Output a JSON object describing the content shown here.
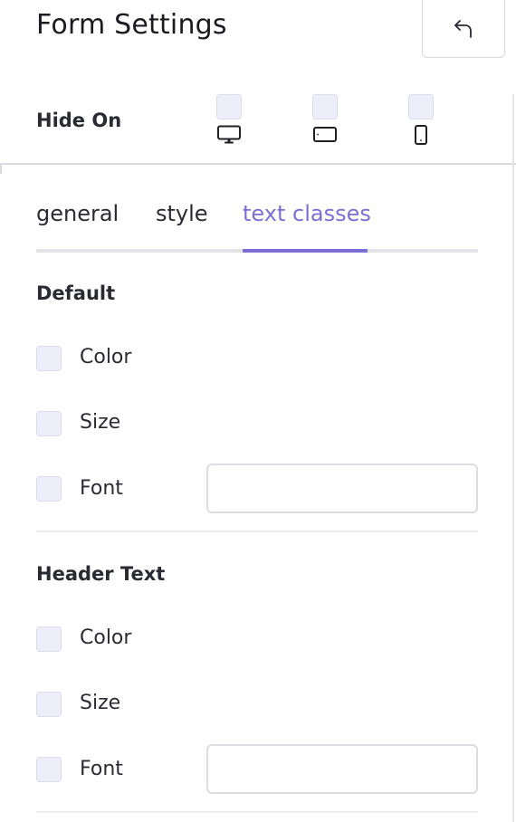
{
  "header": {
    "title": "Form Settings",
    "undo_icon": "undo-arrow-icon"
  },
  "hide_on": {
    "label": "Hide On",
    "devices": [
      {
        "name": "desktop",
        "icon": "desktop-icon",
        "checked": false
      },
      {
        "name": "tablet",
        "icon": "tablet-icon",
        "checked": false
      },
      {
        "name": "mobile",
        "icon": "mobile-icon",
        "checked": false
      }
    ]
  },
  "tabs": [
    {
      "label": "general",
      "active": false
    },
    {
      "label": "style",
      "active": false
    },
    {
      "label": "text classes",
      "active": true
    }
  ],
  "sections": [
    {
      "title": "Default",
      "options": [
        {
          "label": "Color",
          "checked": false
        },
        {
          "label": "Size",
          "checked": false
        },
        {
          "label": "Font",
          "checked": false,
          "input_value": ""
        }
      ]
    },
    {
      "title": "Header Text",
      "options": [
        {
          "label": "Color",
          "checked": false
        },
        {
          "label": "Size",
          "checked": false
        },
        {
          "label": "Font",
          "checked": false,
          "input_value": ""
        }
      ]
    }
  ],
  "colors": {
    "accent": "#7b6fd6",
    "checkbox_fill": "#eeeefb",
    "border": "#dcdce2"
  }
}
